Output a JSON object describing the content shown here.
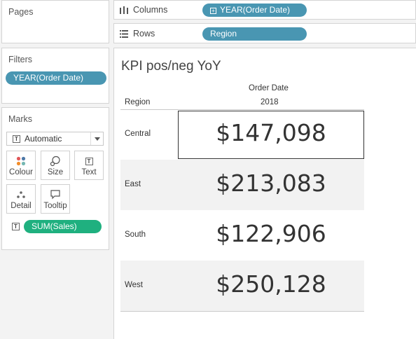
{
  "pages": {
    "title": "Pages"
  },
  "columns_shelf": {
    "label": "Columns",
    "pill": "YEAR(Order Date)"
  },
  "rows_shelf": {
    "label": "Rows",
    "pill": "Region"
  },
  "filters": {
    "title": "Filters",
    "pill": "YEAR(Order Date)"
  },
  "marks": {
    "title": "Marks",
    "mark_type": "Automatic",
    "buttons": {
      "colour": "Colour",
      "size": "Size",
      "text": "Text",
      "detail": "Detail",
      "tooltip": "Tooltip"
    },
    "text_pill": "SUM(Sales)"
  },
  "view": {
    "title": "KPI pos/neg YoY",
    "col_header_field": "Order Date",
    "col_header_value": "2018",
    "row_header_field": "Region",
    "rows": [
      {
        "region": "Central",
        "value": "$147,098"
      },
      {
        "region": "East",
        "value": "$213,083"
      },
      {
        "region": "South",
        "value": "$122,906"
      },
      {
        "region": "West",
        "value": "$250,128"
      }
    ]
  },
  "colors": {
    "dimension_pill": "#4996b2",
    "measure_pill": "#1fb07f",
    "row_shade": "#f2f2f2"
  }
}
